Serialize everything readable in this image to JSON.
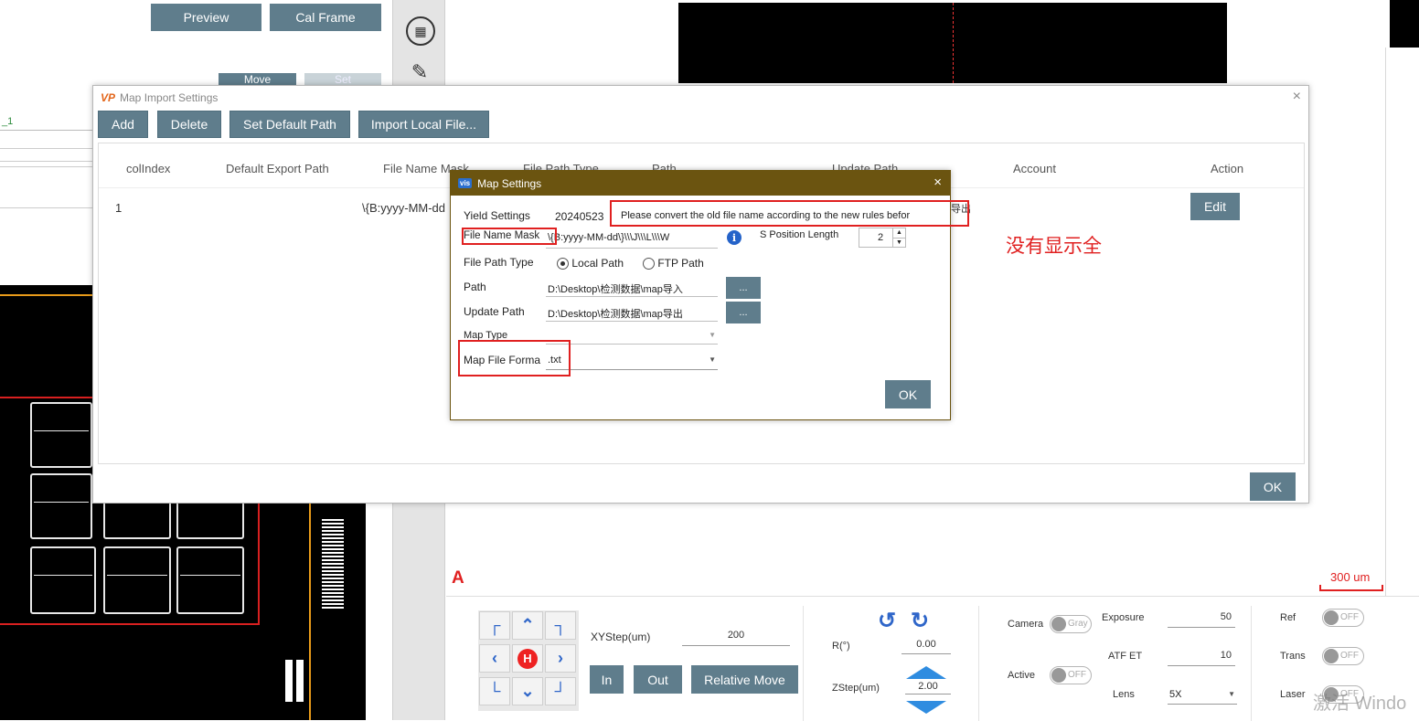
{
  "background": {
    "preview_label": "Preview",
    "cal_frame_label": "Cal Frame",
    "move_label": "Move",
    "set_label": "Set",
    "left_item": "_1",
    "scale_label": "300 um",
    "marker_a": "A",
    "annotation": "没有显示全"
  },
  "main_dialog": {
    "title": "Map Import Settings",
    "close": "×",
    "toolbar": {
      "add": "Add",
      "delete": "Delete",
      "set_default_path": "Set Default Path",
      "import_local_file": "Import Local File..."
    },
    "columns": [
      "colIndex",
      "Default Export Path",
      "File Name Mask",
      "File Path Type",
      "Path",
      "Update Path",
      "Account",
      "Action"
    ],
    "row": {
      "index": "1",
      "mask_partial": "\\{B:yyyy-MM-dd",
      "update_partial": "导出",
      "action": "Edit"
    },
    "ok": "OK"
  },
  "map_settings": {
    "title": "Map Settings",
    "icon": "vis",
    "close": "×",
    "yield_label": "Yield Settings",
    "yield_value": "20240523",
    "warning": "Please convert the old file name according to the new rules befor",
    "mask_label": "File Name Mask",
    "mask_value": "\\{B:yyyy-MM-dd\\}\\\\\\J\\\\\\L\\\\\\W",
    "s_position_label": "S Position Length",
    "s_position_value": "2",
    "path_type_label": "File Path Type",
    "local_path": "Local Path",
    "ftp_path": "FTP Path",
    "path_label": "Path",
    "path_value": "D:\\Desktop\\检测数据\\map导入",
    "update_label": "Update Path",
    "update_value": "D:\\Desktop\\检测数据\\map导出",
    "browse": "...",
    "map_type_label": "Map Type",
    "map_format_label": "Map File Forma",
    "map_format_value": ".txt",
    "ok": "OK"
  },
  "controls": {
    "xystep_label": "XYStep(um)",
    "xystep_value": "200",
    "in_label": "In",
    "out_label": "Out",
    "relative_move": "Relative Move",
    "r_label": "R(°)",
    "r_value": "0.00",
    "zstep_label": "ZStep(um)",
    "zstep_value": "2.00",
    "camera_label": "Camera",
    "camera_toggle": "Gray",
    "active_label": "Active",
    "active_toggle": "OFF",
    "exposure_label": "Exposure",
    "exposure_value": "50",
    "atf_label": "ATF ET",
    "atf_value": "10",
    "lens_label": "Lens",
    "lens_value": "5X",
    "ref_label": "Ref",
    "trans_label": "Trans",
    "laser_label": "Laser",
    "off": "OFF",
    "home": "H",
    "watermark": "激活 Windo"
  },
  "colors": {
    "button": "#5f7d8c",
    "title_bar": "#6b5410",
    "highlight": "#e02020",
    "accent_blue": "#2f66c9"
  }
}
